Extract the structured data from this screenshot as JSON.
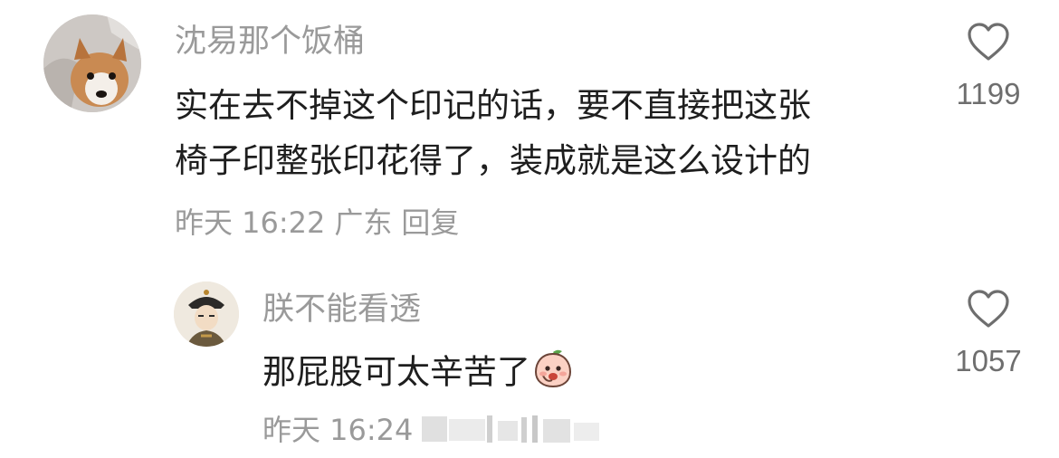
{
  "comments": [
    {
      "username": "沈易那个饭桶",
      "lines": [
        "实在去不掉这个印记的话，要不直接把这张",
        "椅子印整张印花得了，装成就是这么设计的"
      ],
      "time": "昨天 16:22",
      "location": "广东",
      "reply_label": "回复",
      "likes": "1199",
      "avatar_icon": "corgi-dog-avatar-icon"
    },
    {
      "username": "朕不能看透",
      "text": "那屁股可太辛苦了",
      "sticker_icon": "peach-emoji-sticker-icon",
      "time": "昨天 16:24",
      "likes": "1057",
      "avatar_icon": "qing-emperor-avatar-icon"
    }
  ],
  "colors": {
    "meta_gray": "#9a9a9a",
    "text": "#1e1e1e",
    "heart_stroke": "#6e6e6e"
  }
}
